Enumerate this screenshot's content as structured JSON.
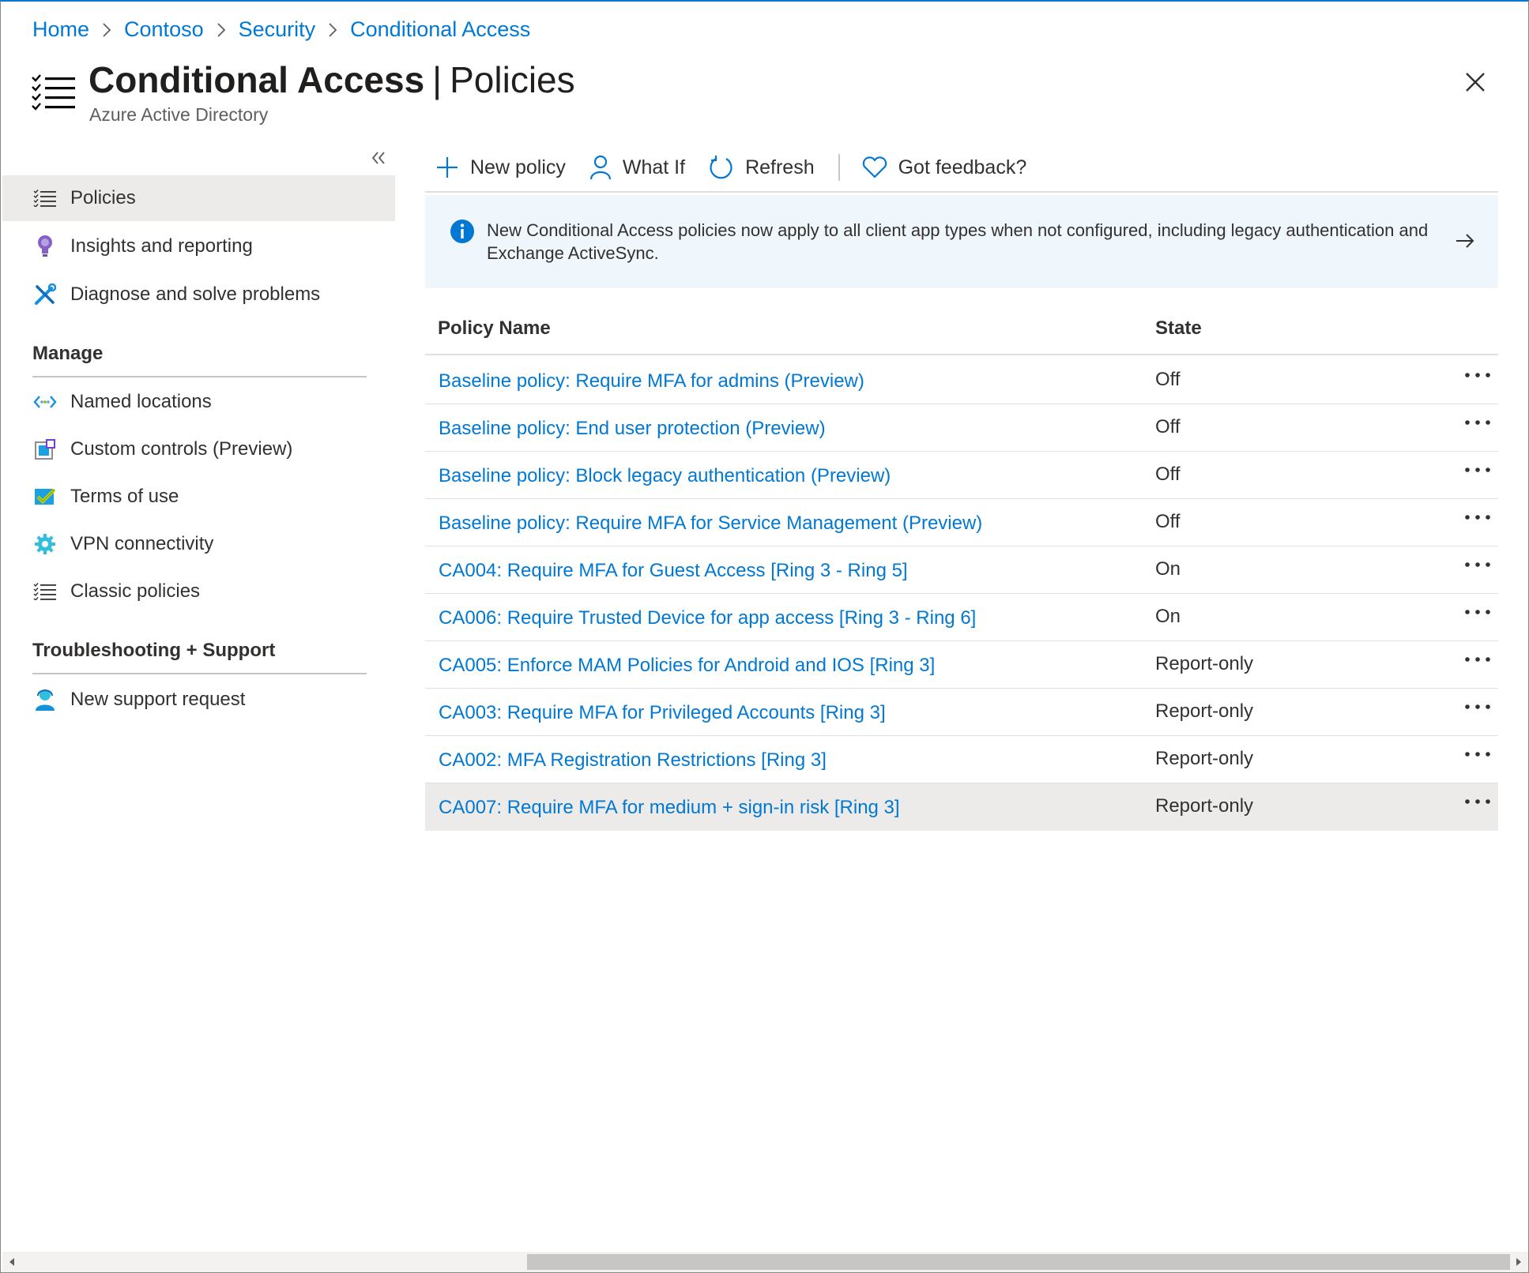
{
  "breadcrumb": [
    "Home",
    "Contoso",
    "Security",
    "Conditional Access"
  ],
  "header": {
    "title_main": "Conditional Access",
    "title_sep": "|",
    "title_sub": "Policies",
    "subtitle": "Azure Active Directory"
  },
  "sidebar": {
    "items": [
      {
        "label": "Policies",
        "icon": "policy-list-icon",
        "selected": true
      },
      {
        "label": "Insights and reporting",
        "icon": "lightbulb-icon"
      },
      {
        "label": "Diagnose and solve problems",
        "icon": "wrench-icon"
      }
    ],
    "manage_heading": "Manage",
    "manage_items": [
      {
        "label": "Named locations",
        "icon": "named-locations-icon"
      },
      {
        "label": "Custom controls (Preview)",
        "icon": "custom-controls-icon"
      },
      {
        "label": "Terms of use",
        "icon": "terms-of-use-icon"
      },
      {
        "label": "VPN connectivity",
        "icon": "gear-icon"
      },
      {
        "label": "Classic policies",
        "icon": "policy-list-icon"
      }
    ],
    "support_heading": "Troubleshooting + Support",
    "support_items": [
      {
        "label": "New support request",
        "icon": "support-person-icon"
      }
    ]
  },
  "toolbar": {
    "new_policy": "New policy",
    "what_if": "What If",
    "refresh": "Refresh",
    "feedback": "Got feedback?"
  },
  "banner": {
    "text": "New Conditional Access policies now apply to all client app types when not configured, including legacy authentication and Exchange ActiveSync."
  },
  "table": {
    "columns": [
      "Policy Name",
      "State"
    ],
    "rows": [
      {
        "name": "Baseline policy: Require MFA for admins (Preview)",
        "state": "Off"
      },
      {
        "name": "Baseline policy: End user protection (Preview)",
        "state": "Off"
      },
      {
        "name": "Baseline policy: Block legacy authentication (Preview)",
        "state": "Off"
      },
      {
        "name": "Baseline policy: Require MFA for Service Management (Preview)",
        "state": "Off"
      },
      {
        "name": "CA004: Require MFA for Guest Access [Ring 3 - Ring 5]",
        "state": "On"
      },
      {
        "name": "CA006: Require Trusted Device for app access [Ring 3 - Ring 6]",
        "state": "On"
      },
      {
        "name": "CA005: Enforce MAM Policies for Android and IOS [Ring 3]",
        "state": "Report-only"
      },
      {
        "name": "CA003: Require MFA for Privileged Accounts [Ring 3]",
        "state": "Report-only"
      },
      {
        "name": "CA002: MFA Registration Restrictions [Ring 3]",
        "state": "Report-only"
      },
      {
        "name": "CA007: Require MFA for medium + sign-in risk [Ring 3]",
        "state": "Report-only"
      }
    ]
  },
  "colors": {
    "accent": "#0078d4",
    "selected_bg": "#edebe9",
    "banner_bg": "#eff6fc",
    "text": "#323130"
  }
}
